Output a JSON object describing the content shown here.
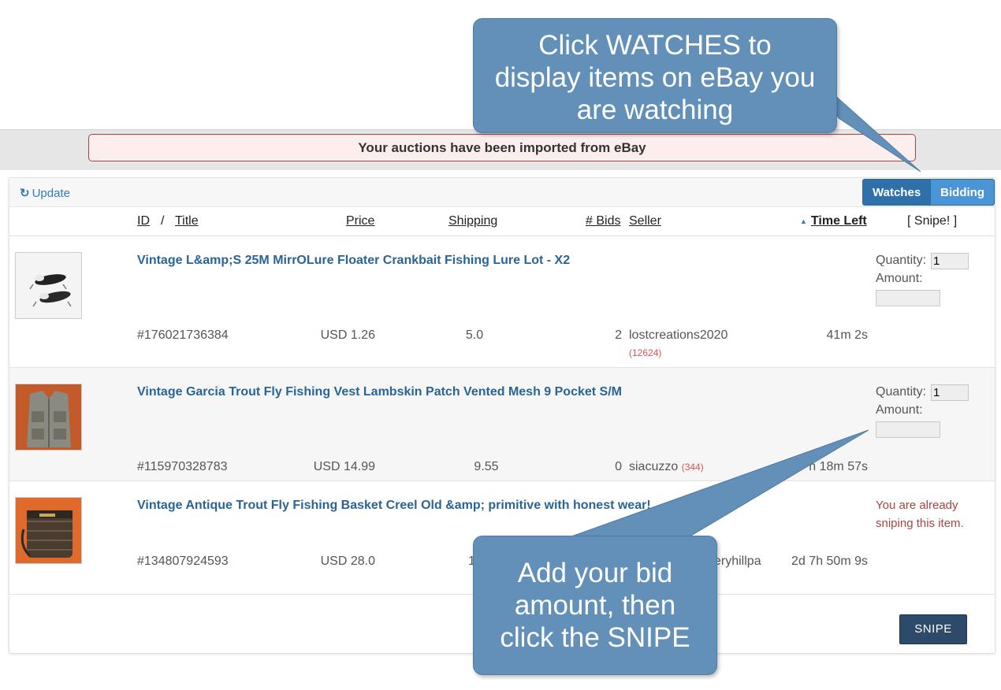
{
  "alert": {
    "message": "Your auctions have been imported from eBay"
  },
  "toolbar": {
    "update_label": "Update",
    "update_icon": "refresh-icon",
    "tabs": [
      {
        "label": "Watches",
        "active": true
      },
      {
        "label": "Bidding",
        "active": false
      }
    ]
  },
  "columns": {
    "id": "ID",
    "separator": "/",
    "title": "Title",
    "price": "Price",
    "shipping": "Shipping",
    "bids": "# Bids",
    "seller": "Seller",
    "time_left": "Time Left",
    "snipe": "[ Snipe! ]"
  },
  "items": [
    {
      "title": "Vintage L&amp;S 25M MirrOLure Floater Crankbait Fishing Lure Lot - X2",
      "id": "#176021736384",
      "price": "USD 1.26",
      "shipping": "5.0",
      "bids": "2",
      "seller": "lostcreations2020",
      "feedback": "(12624)",
      "time_left": "41m 2s",
      "quantity_label": "Quantity:",
      "quantity_value": "1",
      "amount_label": "Amount:"
    },
    {
      "title": "Vintage Garcia Trout Fly Fishing Vest Lambskin Patch Vented Mesh 9 Pocket S/M",
      "id": "#115970328783",
      "price": "USD 14.99",
      "shipping": "9.55",
      "bids": "0",
      "seller": "siacuzzo",
      "feedback": "(344)",
      "time_left": "h 18m 57s",
      "quantity_label": "Quantity:",
      "quantity_value": "1",
      "amount_label": "Amount:"
    },
    {
      "title": "Vintage Antique Trout Fly Fishing Basket Creel Old &amp; primitive with honest wear!",
      "id": "#134807924593",
      "price": "USD 28.0",
      "shipping": "1",
      "seller": "eryhillpa",
      "time_left": "2d 7h 50m 9s",
      "status": "You are already sniping this item."
    }
  ],
  "snipe_button": "SNIPE",
  "callouts": {
    "top": [
      "Click WATCHES to",
      "display items on eBay you",
      "are watching"
    ],
    "bottom": [
      "Add your bid",
      "amount, then",
      "click the SNIPE"
    ]
  },
  "colors": {
    "link_blue": "#2a6496",
    "callout_blue": "#6290b8",
    "alert_border": "#a94442",
    "feedback_red": "#d9534f",
    "snipe_button": "#2d4a6a"
  }
}
